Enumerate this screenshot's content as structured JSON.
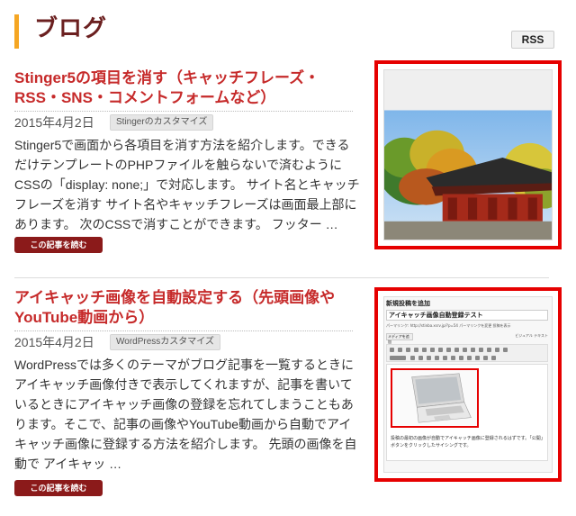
{
  "header": {
    "title": "ブログ",
    "rss_label": "RSS"
  },
  "posts": [
    {
      "title": "Stinger5の項目を消す（キャッチフレーズ・RSS・SNS・コメントフォームなど）",
      "date": "2015年4月2日",
      "category": "Stingerのカスタマイズ",
      "excerpt": "Stinger5で画面から各項目を消す方法を紹介します。できるだけテンプレートのPHPファイルを触らないで済むようにCSSの「display: none;」で対応します。 サイト名とキャッチフレーズを消す サイト名やキャッチフレーズは画面最上部にあります。 次のCSSで消すことができます。 フッター …",
      "read_more": "この記事を読む"
    },
    {
      "title": "アイキャッチ画像を自動設定する（先頭画像やYouTube動画から）",
      "date": "2015年4月2日",
      "category": "WordPressカスタマイズ",
      "excerpt": "WordPressでは多くのテーマがブログ記事を一覧するときにアイキャッチ画像付きで表示してくれますが、記事を書いているときにアイキャッチ画像の登録を忘れてしまうこともあります。そこで、記事の画像やYouTube動画から自動でアイキャッチ画像に登録する方法を紹介します。 先頭の画像を自動で アイキャッ …",
      "read_more": "この記事を読む",
      "thumb": {
        "heading": "新規投稿を追加",
        "post_title": "アイキャッチ画像自動登録テスト",
        "permalink": "パーマリンク: http://stinba.xsrv.jp/?p=54  パーマリンクを変更  投稿を表示",
        "media_button": "メディアを追加",
        "editor_tabs": "ビジュアル  テキスト",
        "body_text": "投稿の最初の画像が自動でアイキャッチ画像に登録されるはずです。「公開」ボタンをクリックしたサイシングです。"
      }
    }
  ],
  "colors": {
    "accent_bar": "#f5a623",
    "title_red": "#c62a2a",
    "button_dark_red": "#8b1a1a",
    "highlight_frame": "#e60000"
  }
}
